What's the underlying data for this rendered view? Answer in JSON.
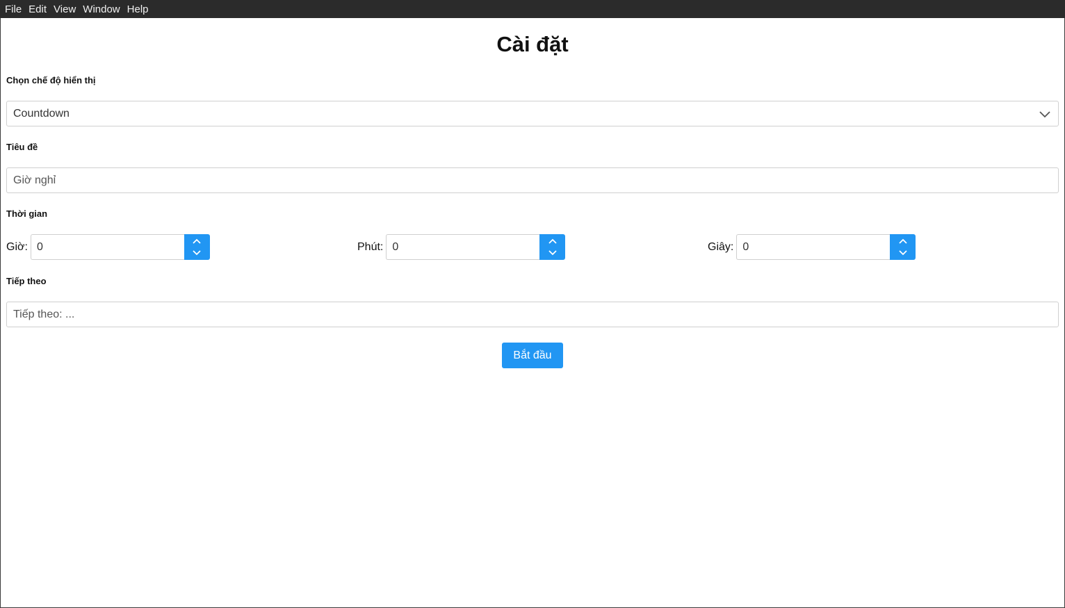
{
  "menu": [
    "File",
    "Edit",
    "View",
    "Window",
    "Help"
  ],
  "page": {
    "title": "Cài đặt"
  },
  "mode": {
    "label": "Chọn chế độ hiển thị",
    "selected": "Countdown"
  },
  "title_field": {
    "label": "Tiêu đề",
    "placeholder": "Giờ nghỉ"
  },
  "time": {
    "label": "Thời gian",
    "hours": {
      "label": "Giờ:",
      "value": "0"
    },
    "minutes": {
      "label": "Phút:",
      "value": "0"
    },
    "seconds": {
      "label": "Giây:",
      "value": "0"
    }
  },
  "next_field": {
    "label": "Tiếp theo",
    "placeholder": "Tiếp theo: ..."
  },
  "start_button": {
    "label": "Bắt đầu"
  },
  "colors": {
    "accent": "#2196f3",
    "menubar": "#2b2b2b"
  },
  "icons": {
    "select": "chevron-down-icon",
    "spin_up": "chevron-up-icon",
    "spin_down": "chevron-down-icon"
  }
}
